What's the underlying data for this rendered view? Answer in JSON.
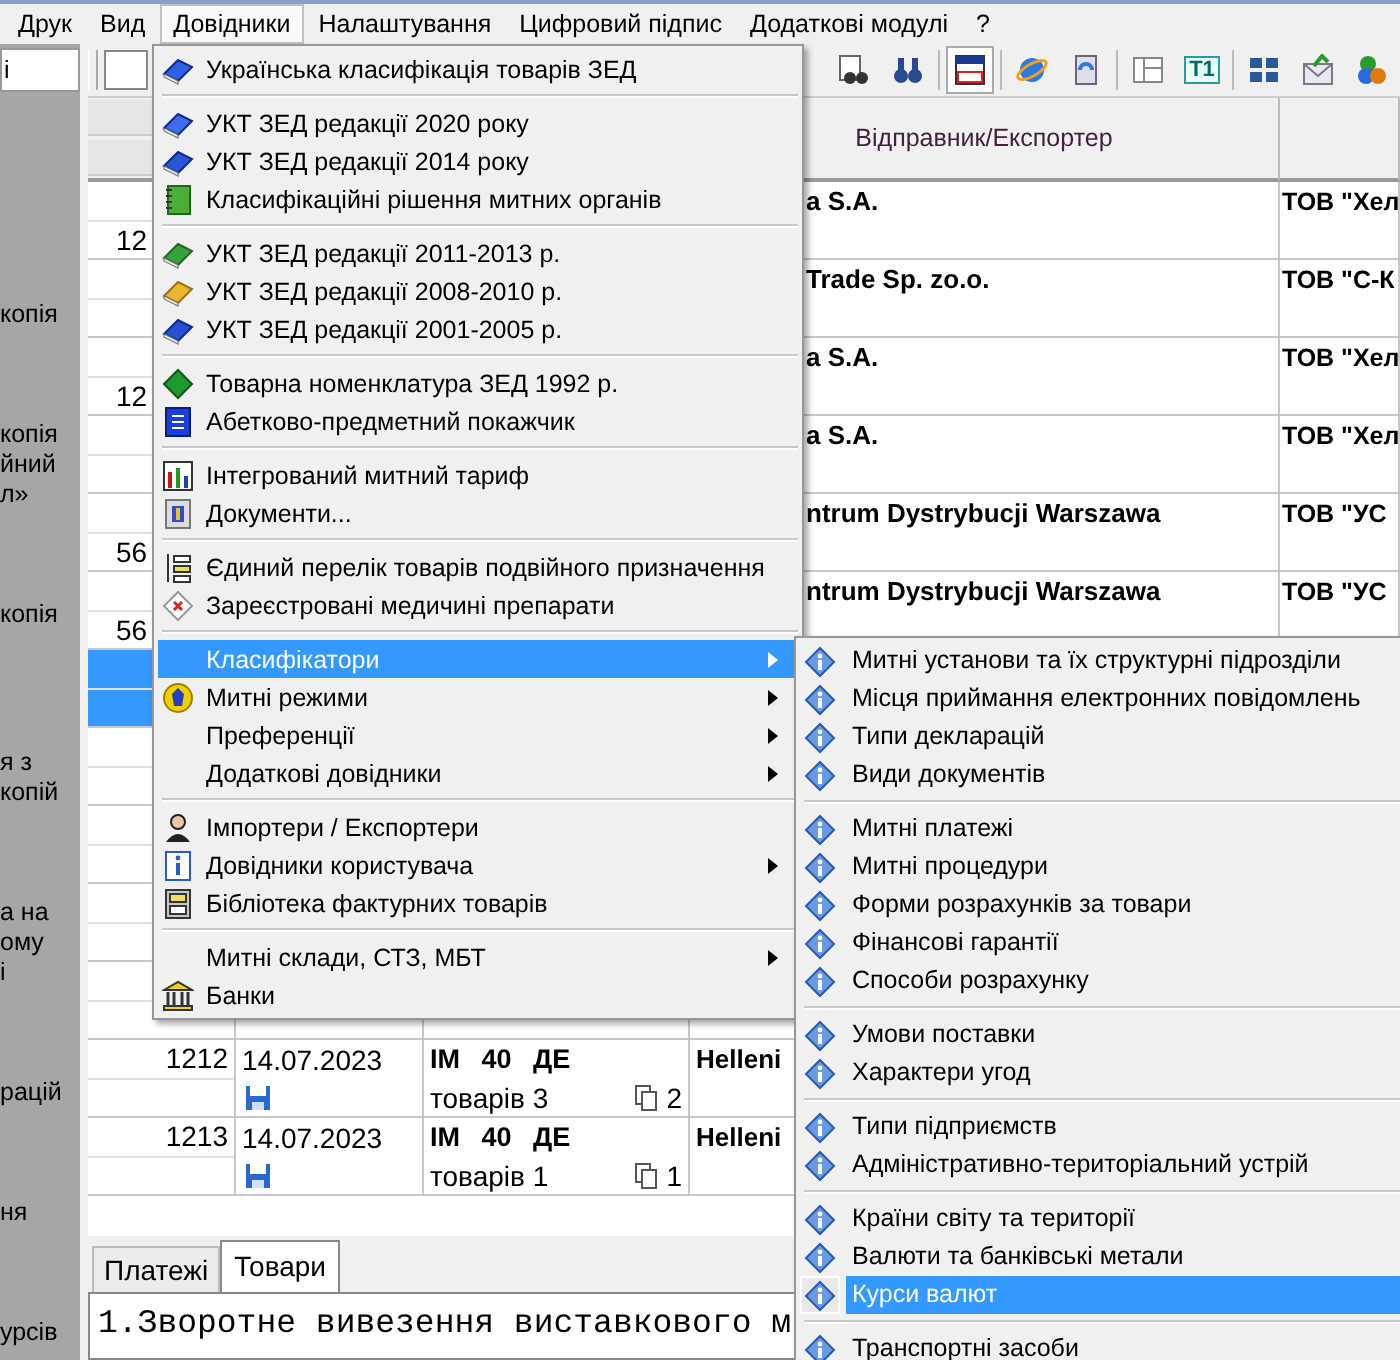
{
  "menubar": [
    {
      "label": "Друк",
      "selected": false
    },
    {
      "label": "Вид",
      "selected": false
    },
    {
      "label": "Довідники",
      "selected": true
    },
    {
      "label": "Налаштування",
      "selected": false
    },
    {
      "label": "Цифровий підпис",
      "selected": false
    },
    {
      "label": "Додаткові модулі",
      "selected": false
    },
    {
      "label": "?",
      "selected": false
    }
  ],
  "toolbar": {
    "buttons": [
      {
        "pressed": false
      },
      {
        "pressed": false
      },
      {
        "pressed": true
      },
      {
        "pressed": false
      },
      {
        "pressed": false
      },
      {
        "pressed": false
      },
      {
        "pressed": false,
        "label": "T1"
      },
      {
        "pressed": false
      },
      {
        "pressed": false
      },
      {
        "pressed": false
      }
    ]
  },
  "sidebar": {
    "header": "і",
    "fragments": [
      [
        "копія"
      ],
      [
        "копія",
        "йний",
        "л»"
      ],
      [
        "копія"
      ],
      [
        "я з",
        "копій"
      ],
      [
        "а на",
        "ому",
        "і"
      ],
      [
        "рацій"
      ],
      [
        "ня"
      ],
      [
        "урсів"
      ]
    ]
  },
  "table": {
    "header": "Відправник/Експортер",
    "rows": [
      {
        "kind": "covered",
        "number": "12",
        "exporter": "a S.A.",
        "importer": "ТОВ \"Хел",
        "selected": false
      },
      {
        "kind": "covered",
        "exporter": "Trade Sp. zo.o.",
        "importer": "ТОВ \"С-К",
        "selected": false
      },
      {
        "kind": "covered",
        "number": "12",
        "exporter": "a S.A.",
        "importer": "ТОВ \"Хел",
        "selected": false
      },
      {
        "kind": "covered",
        "exporter": "a S.A.",
        "importer": "ТОВ \"Хел",
        "selected": false
      },
      {
        "kind": "covered",
        "number": "56",
        "exporter": "ntrum Dystrybucji Warszawa",
        "importer": "ТОВ \"УС",
        "selected": false
      },
      {
        "kind": "covered",
        "number": "56",
        "exporter": "ntrum Dystrybucji Warszawa",
        "importer": "ТОВ \"УС",
        "selected": false
      },
      {
        "kind": "covered",
        "selected": true
      },
      {
        "kind": "covered",
        "selected": false
      },
      {
        "kind": "covered",
        "selected": false
      },
      {
        "kind": "covered",
        "selected": false
      },
      {
        "kind": "covered",
        "selected": false
      },
      {
        "kind": "full",
        "number": "1212",
        "date": "14.07.2023",
        "declaration": "IM 40 ДЕ",
        "goods": "товарів 3",
        "copies": "2",
        "exporter": "Helleni",
        "selected": false
      },
      {
        "kind": "full",
        "number": "1213",
        "date": "14.07.2023",
        "declaration": "IM 40 ДЕ",
        "goods": "товарів 1",
        "copies": "1",
        "exporter": "Helleni",
        "selected": false
      }
    ]
  },
  "bottom_tabs": [
    {
      "label": "Платежі",
      "selected": false
    },
    {
      "label": "Товари",
      "selected": true
    }
  ],
  "note_text": "1.Зворотне вивезення виставкового м",
  "menu": {
    "groups": [
      [
        {
          "label": "Українська класифікація товарів ЗЕД",
          "selected": false,
          "submenu": false
        }
      ],
      [
        {
          "label": "УКТ ЗЕД редакції 2020 року",
          "selected": false,
          "submenu": false
        },
        {
          "label": "УКТ ЗЕД редакції 2014 року",
          "selected": false,
          "submenu": false
        },
        {
          "label": "Класифікаційні рішення митних органів",
          "selected": false,
          "submenu": false
        }
      ],
      [
        {
          "label": "УКТ ЗЕД редакції 2011-2013 р.",
          "selected": false,
          "submenu": false
        },
        {
          "label": "УКТ ЗЕД редакції 2008-2010 р.",
          "selected": false,
          "submenu": false
        },
        {
          "label": "УКТ ЗЕД редакції 2001-2005 р.",
          "selected": false,
          "submenu": false
        }
      ],
      [
        {
          "label": "Товарна номенклатура ЗЕД 1992 р.",
          "selected": false,
          "submenu": false
        },
        {
          "label": "Абетково-предметний покажчик",
          "selected": false,
          "submenu": false
        }
      ],
      [
        {
          "label": "Інтегрований митний тариф",
          "selected": false,
          "submenu": false
        },
        {
          "label": "Документи...",
          "selected": false,
          "submenu": false
        }
      ],
      [
        {
          "label": "Єдиний перелік товарів подвійного призначення",
          "selected": false,
          "submenu": false
        },
        {
          "label": "Зареєстровані медичині препарати",
          "selected": false,
          "submenu": false
        }
      ],
      [
        {
          "label": "Класифікатори",
          "selected": true,
          "submenu": true
        },
        {
          "label": "Митні режими",
          "selected": false,
          "submenu": true
        },
        {
          "label": "Преференції",
          "selected": false,
          "submenu": true
        },
        {
          "label": "Додаткові довідники",
          "selected": false,
          "submenu": true
        }
      ],
      [
        {
          "label": "Імпортери / Експортери",
          "selected": false,
          "submenu": false
        },
        {
          "label": "Довідники користувача",
          "selected": false,
          "submenu": true
        },
        {
          "label": "Бібліотека фактурних товарів",
          "selected": false,
          "submenu": false
        }
      ],
      [
        {
          "label": "Митні склади, СТЗ, МБТ",
          "selected": false,
          "submenu": true
        },
        {
          "label": "Банки",
          "selected": false,
          "submenu": false
        }
      ]
    ]
  },
  "submenu": {
    "groups": [
      [
        {
          "label": "Митні установи та їх структурні підрозділи",
          "selected": false
        },
        {
          "label": "Місця приймання електронних повідомлень",
          "selected": false
        },
        {
          "label": "Типи декларацій",
          "selected": false
        },
        {
          "label": "Види документів",
          "selected": false
        }
      ],
      [
        {
          "label": "Митні платежі",
          "selected": false
        },
        {
          "label": "Митні процедури",
          "selected": false
        },
        {
          "label": "Форми розрахунків за товари",
          "selected": false
        },
        {
          "label": "Фінансові гарантії",
          "selected": false
        },
        {
          "label": "Способи розрахунку",
          "selected": false
        }
      ],
      [
        {
          "label": "Умови поставки",
          "selected": false
        },
        {
          "label": "Характери угод",
          "selected": false
        }
      ],
      [
        {
          "label": "Типи підприємств",
          "selected": false
        },
        {
          "label": "Адміністративно-територіальний устрій",
          "selected": false
        }
      ],
      [
        {
          "label": "Країни світу та території",
          "selected": false
        },
        {
          "label": "Валюти та банківські метали",
          "selected": false
        },
        {
          "label": "Курси валют",
          "selected": true
        }
      ],
      [
        {
          "label": "Транспортні засоби",
          "selected": false
        }
      ]
    ]
  }
}
